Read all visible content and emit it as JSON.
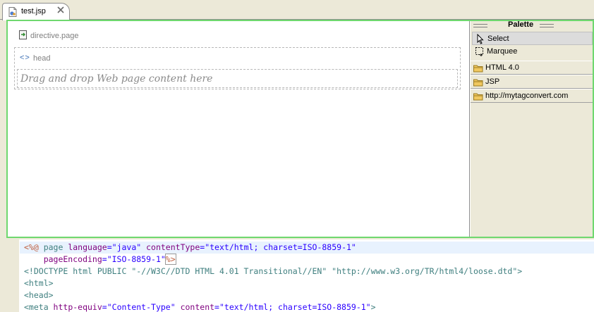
{
  "editor": {
    "tab_label": "test.jsp"
  },
  "design": {
    "directive_label": "directive.page",
    "head_label": "head",
    "head_chevron": "<>",
    "drop_placeholder": "Drag and drop Web page content here"
  },
  "palette": {
    "title": "Palette",
    "tools": [
      {
        "label": "Select",
        "icon": "arrow-pointer-icon"
      },
      {
        "label": "Marquee",
        "icon": "marquee-icon"
      }
    ],
    "drawers": [
      {
        "label": "HTML 4.0",
        "icon": "folder-icon"
      },
      {
        "label": "JSP",
        "icon": "folder-icon"
      },
      {
        "label": "http://mytagconvert.com",
        "icon": "folder-icon"
      }
    ]
  },
  "source": {
    "lines": [
      {
        "open": "<%@",
        "kw": " page ",
        "a1": "language",
        "v1": "=\"java\"",
        "a2": " contentType",
        "v2": "=\"text/html; charset=ISO-8859-1\""
      },
      {
        "a1": "    pageEncoding",
        "v1": "=\"ISO-8859-1\"",
        "close": "%>"
      },
      {
        "text": "<!DOCTYPE html PUBLIC \"-//W3C//DTD HTML 4.01 Transitional//EN\" \"http://www.w3.org/TR/html4/loose.dtd\">"
      },
      {
        "text": "<html>"
      },
      {
        "text": "<head>"
      },
      {
        "tag": "<meta",
        "a1": " http-equiv",
        "v1": "=\"Content-Type\"",
        "a2": " content",
        "v2": "=\"text/html; charset=ISO-8859-1\"",
        "end": ">"
      }
    ]
  },
  "colors": {
    "frame_border": "#6fd86f",
    "jsp_delimiter": "#bf5f3f",
    "attribute": "#7f007f",
    "value": "#2a00ff",
    "tag": "#3f7f7f",
    "current_line": "#e8f2fe"
  }
}
